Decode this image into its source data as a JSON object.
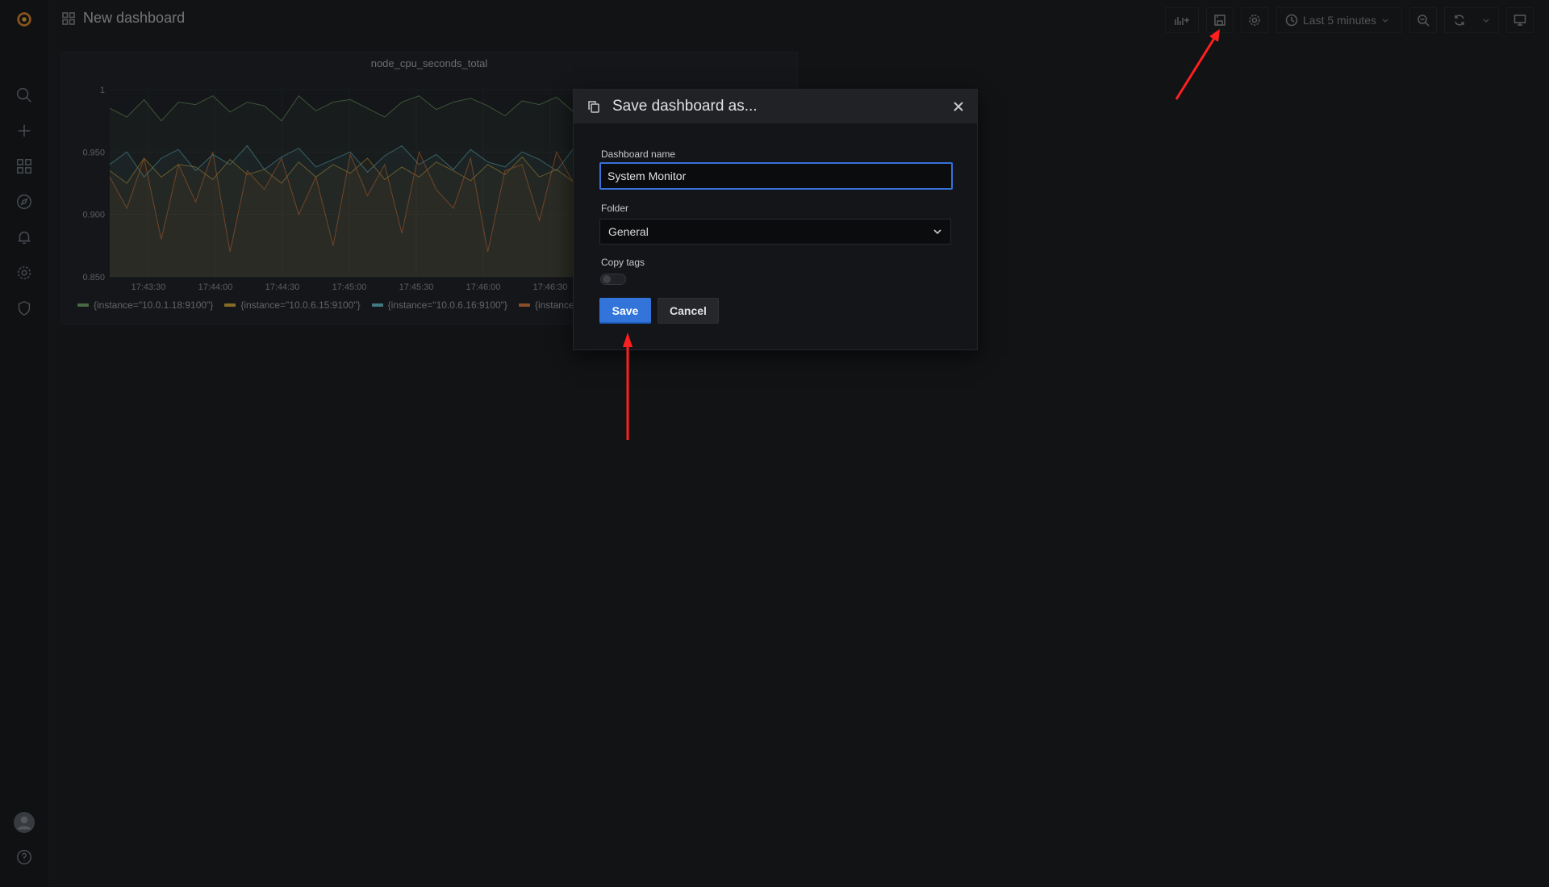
{
  "header": {
    "dashboard_title": "New dashboard",
    "time_range": "Last 5 minutes"
  },
  "sidebar": {
    "items": [
      "grafana-logo-icon",
      "search-icon",
      "plus-icon",
      "dashboards-icon",
      "explore-icon",
      "alerting-icon",
      "configuration-icon",
      "shield-icon"
    ],
    "bottom": [
      "avatar",
      "help-icon"
    ]
  },
  "panel": {
    "title": "node_cpu_seconds_total",
    "legend": [
      {
        "label": "{instance=\"10.0.1.18:9100\"}",
        "color": "#7eb26d"
      },
      {
        "label": "{instance=\"10.0.6.15:9100\"}",
        "color": "#eab839"
      },
      {
        "label": "{instance=\"10.0.6.16:9100\"}",
        "color": "#6ed0e0"
      },
      {
        "label": "{instance=",
        "color": "#ef843c"
      }
    ]
  },
  "chart_data": {
    "type": "area",
    "title": "node_cpu_seconds_total",
    "ylim": [
      0.85,
      1.0
    ],
    "y_ticks": [
      "1",
      "0.950",
      "0.900",
      "0.850"
    ],
    "x_ticks": [
      "17:43:30",
      "17:44:00",
      "17:44:30",
      "17:45:00",
      "17:45:30",
      "17:46:00",
      "17:46:30"
    ],
    "grid": true,
    "series": [
      {
        "name": "{instance=\"10.0.1.18:9100\"}",
        "color": "#7eb26d",
        "values": [
          0.985,
          0.978,
          0.992,
          0.975,
          0.99,
          0.988,
          0.995,
          0.982,
          0.99,
          0.987,
          0.975,
          0.995,
          0.983,
          0.99,
          0.992,
          0.985,
          0.978,
          0.99,
          0.995,
          0.984,
          0.99,
          0.993,
          0.987,
          0.979,
          0.991,
          0.988,
          0.994,
          0.982,
          0.99,
          0.996,
          0.988,
          0.981,
          0.992,
          0.985,
          0.99,
          0.978,
          0.993,
          0.987,
          0.99,
          0.984,
          0.992
        ]
      },
      {
        "name": "{instance=\"10.0.6.15:9100\"}",
        "color": "#eab839",
        "values": [
          0.935,
          0.925,
          0.945,
          0.93,
          0.94,
          0.938,
          0.928,
          0.944,
          0.932,
          0.936,
          0.925,
          0.942,
          0.93,
          0.94,
          0.933,
          0.945,
          0.928,
          0.938,
          0.93,
          0.942,
          0.935,
          0.927,
          0.94,
          0.932,
          0.946,
          0.93,
          0.936,
          0.926,
          0.944,
          0.934,
          0.94,
          0.928,
          0.936,
          0.943,
          0.93,
          0.938,
          0.926,
          0.945,
          0.932,
          0.94,
          0.935
        ]
      },
      {
        "name": "{instance=\"10.0.6.16:9100\"}",
        "color": "#6ed0e0",
        "values": [
          0.94,
          0.95,
          0.93,
          0.945,
          0.952,
          0.935,
          0.948,
          0.94,
          0.955,
          0.936,
          0.946,
          0.953,
          0.938,
          0.944,
          0.95,
          0.934,
          0.947,
          0.955,
          0.94,
          0.948,
          0.936,
          0.952,
          0.942,
          0.938,
          0.95,
          0.944,
          0.935,
          0.953,
          0.94,
          0.946,
          0.952,
          0.937,
          0.948,
          0.943,
          0.955,
          0.94,
          0.946,
          0.936,
          0.95,
          0.944,
          0.94
        ]
      },
      {
        "name": "{instance=",
        "color": "#ef843c",
        "values": [
          0.93,
          0.905,
          0.945,
          0.88,
          0.94,
          0.91,
          0.95,
          0.87,
          0.935,
          0.92,
          0.945,
          0.9,
          0.93,
          0.875,
          0.948,
          0.915,
          0.94,
          0.885,
          0.95,
          0.92,
          0.905,
          0.945,
          0.87,
          0.935,
          0.94,
          0.895,
          0.95,
          0.925,
          0.88,
          0.94,
          0.91,
          0.945,
          0.9,
          0.935,
          0.875,
          0.95,
          0.92,
          0.94,
          0.9,
          0.945,
          0.93
        ]
      }
    ]
  },
  "modal": {
    "title": "Save dashboard as...",
    "name_label": "Dashboard name",
    "name_value": "System Monitor",
    "folder_label": "Folder",
    "folder_value": "General",
    "copy_tags_label": "Copy tags",
    "copy_tags_on": false,
    "save_label": "Save",
    "cancel_label": "Cancel"
  },
  "colors": {
    "accent": "#3274d9",
    "background": "#161719",
    "annotation_arrow": "#ff1f1f"
  }
}
